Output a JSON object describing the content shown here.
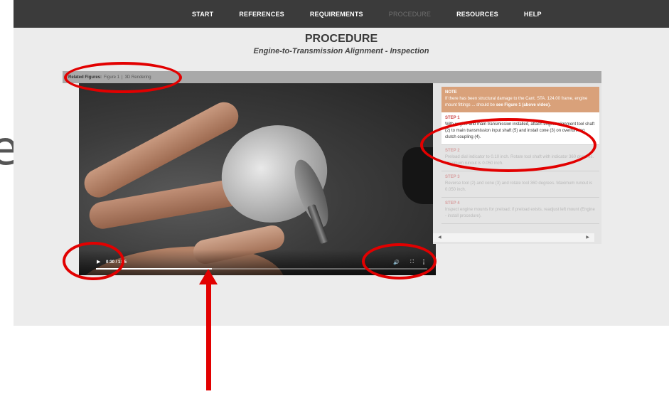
{
  "slide": {
    "glyph": "e"
  },
  "nav": {
    "items": [
      {
        "label": "START",
        "active": false
      },
      {
        "label": "REFERENCES",
        "active": false
      },
      {
        "label": "REQUIREMENTS",
        "active": false
      },
      {
        "label": "PROCEDURE",
        "active": true
      },
      {
        "label": "RESOURCES",
        "active": false
      },
      {
        "label": "HELP",
        "active": false
      }
    ]
  },
  "page": {
    "title": "PROCEDURE",
    "subtitle": "Engine-to-Transmission Alignment - Inspection"
  },
  "related": {
    "label": "Related Figures:",
    "links": [
      "Figure 1",
      "3D Rendering"
    ],
    "separator": "|"
  },
  "video": {
    "time": "0:30 / 1:25",
    "progress": 0.35,
    "icons": [
      "play-icon",
      "volume-icon",
      "fullscreen-icon",
      "more-options-icon"
    ]
  },
  "steps": {
    "note": {
      "title": "NOTE",
      "text": "If there has been structural damage to the Cant. STA. 124.00 frame, engine mount fittings ... should be",
      "link": "see Figure 1 (above video)."
    },
    "items": [
      {
        "title": "STEP 1",
        "text": "With engine and main transmission installed, attach engine alignment tool shaft (2) to main transmission input shaft (5) and install cone (3) on overrunning clutch coupling (4).",
        "active": true
      },
      {
        "title": "STEP 2",
        "text": "Preload dial indicator to 0.10 inch. Rotate tool shaft with indicator 360 degrees. Maximum runout is 0.050 inch.",
        "active": false
      },
      {
        "title": "STEP 3",
        "text": "Reverse tool (2) and cone (3) and rotate tool 360 degrees. Maximum runout is 0.050 inch.",
        "active": false
      },
      {
        "title": "STEP 4",
        "text": "Inspect engine mounts for preload; if preload exists, readjust left mount (Engine - install procedure).",
        "active": false
      }
    ]
  },
  "annotation": {
    "color": "#e20000"
  }
}
